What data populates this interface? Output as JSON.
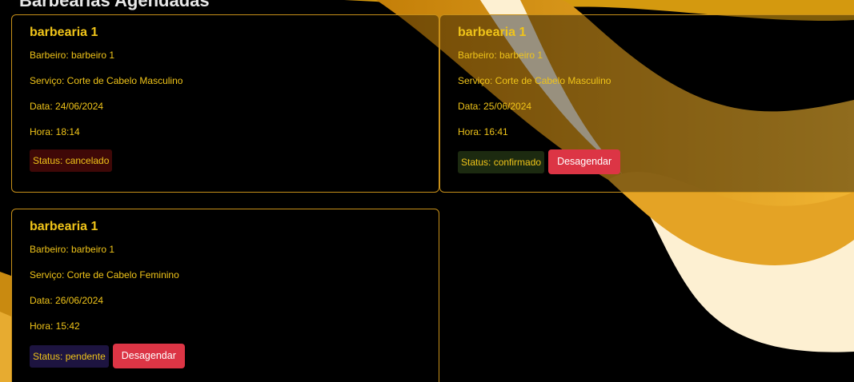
{
  "page": {
    "heading": "Barbearias Agendadas"
  },
  "labels": {
    "barber_prefix": "Barbeiro: ",
    "service_prefix": "Serviço: ",
    "date_prefix": "Data: ",
    "time_prefix": "Hora: ",
    "status_prefix": "Status: ",
    "unschedule_button": "Desagendar"
  },
  "appointments": [
    {
      "shop": "barbearia 1",
      "barber": "Barbeiro: barbeiro 1",
      "service": "Serviço: Corte de Cabelo Masculino",
      "date": "Data: 24/06/2024",
      "time": "Hora: 18:14",
      "status": "Status: cancelado",
      "status_value": "cancelado",
      "can_unschedule": false
    },
    {
      "shop": "barbearia 1",
      "barber": "Barbeiro: barbeiro 1",
      "service": "Serviço: Corte de Cabelo Masculino",
      "date": "Data: 25/06/2024",
      "time": "Hora: 16:41",
      "status": "Status: confirmado",
      "status_value": "confirmado",
      "can_unschedule": true,
      "button": "Desagendar"
    },
    {
      "shop": "barbearia 1",
      "barber": "Barbeiro: barbeiro 1",
      "service": "Serviço: Corte de Cabelo Feminino",
      "date": "Data: 26/06/2024",
      "time": "Hora: 15:42",
      "status": "Status: pendente",
      "status_value": "pendente",
      "can_unschedule": true,
      "button": "Desagendar"
    }
  ],
  "colors": {
    "accent_text": "#f0c419",
    "card_border": "#c8901a",
    "danger": "#dc3545",
    "status_cancelado_bg": "#3f0807",
    "status_confirmado_bg": "#1c2a10",
    "status_pendente_bg": "#1d1440",
    "wave_gold_dark": "#c88a0c",
    "wave_gold": "#e8a92a",
    "wave_cream": "#fdf0d2"
  }
}
